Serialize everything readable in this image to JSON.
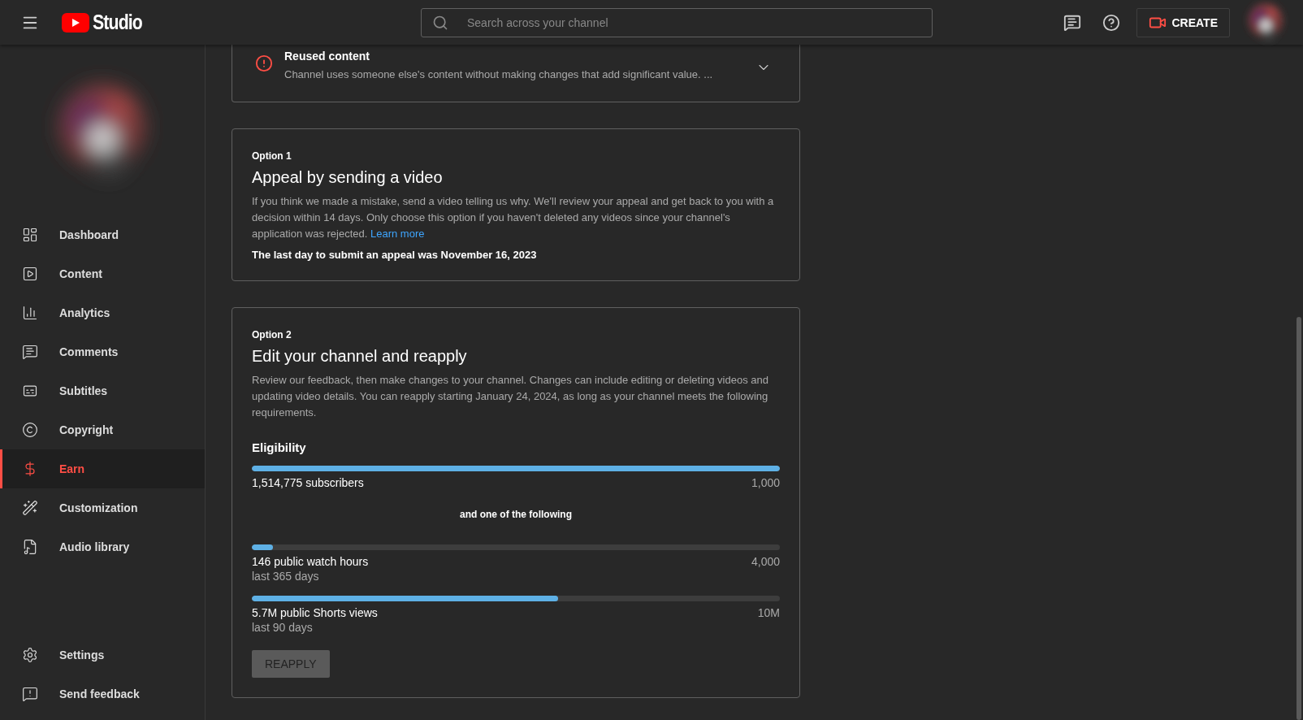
{
  "header": {
    "logo_text": "Studio",
    "search": {
      "placeholder": "Search across your channel"
    },
    "create_button": "CREATE"
  },
  "sidebar": {
    "items": [
      {
        "label": "Dashboard",
        "selected": false
      },
      {
        "label": "Content",
        "selected": false
      },
      {
        "label": "Analytics",
        "selected": false
      },
      {
        "label": "Comments",
        "selected": false
      },
      {
        "label": "Subtitles",
        "selected": false
      },
      {
        "label": "Copyright",
        "selected": false
      },
      {
        "label": "Earn",
        "selected": true
      },
      {
        "label": "Customization",
        "selected": false
      },
      {
        "label": "Audio library",
        "selected": false
      }
    ],
    "footer_items": [
      {
        "label": "Settings"
      },
      {
        "label": "Send feedback"
      }
    ]
  },
  "issue": {
    "title": "Reused content",
    "description": "Channel uses someone else's content without making changes that add significant value. ...",
    "expanded": false
  },
  "options": [
    {
      "eyebrow": "Option 1",
      "title": "Appeal by sending a video",
      "description": "If you think we made a mistake, send a video telling us why. We'll review your appeal and get back to you with a decision within 14 days. Only choose this option if you haven't deleted any videos since your channel's application was rejected.",
      "link": "Learn more",
      "note": "The last day to submit an appeal was November 16, 2023"
    },
    {
      "eyebrow": "Option 2",
      "title": "Edit your channel and reapply",
      "description": "Review our feedback, then make changes to your channel. Changes can include editing or deleting videos and updating video details. You can reapply starting January 24, 2024, as long as your channel meets the following requirements.",
      "eligibility": {
        "title": "Eligibility",
        "main": {
          "label": "1,514,775 subscribers",
          "target": "1,000",
          "level": 1
        },
        "connector": "and one of the following",
        "requirements": [
          {
            "label": "146 public watch hours",
            "sub": "last 365 days",
            "target": "4,000",
            "level": 0.04
          },
          {
            "label": "5.7M public Shorts views",
            "sub": "last 90 days",
            "target": "10M",
            "level": 0.58
          }
        ]
      },
      "button": {
        "label": "REAPPLY",
        "disabled": true
      }
    }
  ]
}
